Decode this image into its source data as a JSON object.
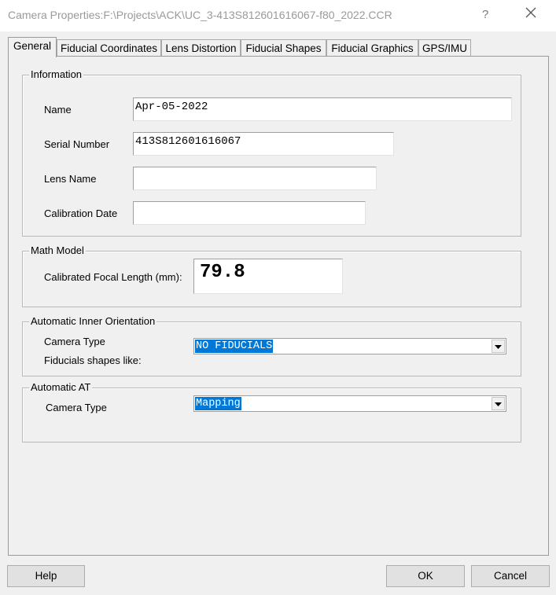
{
  "window": {
    "title": "Camera Properties:F:\\Projects\\ACK\\UC_3-413S812601616067-f80_2022.CCR",
    "help_glyph": "?",
    "close_icon": "close-icon"
  },
  "tabs": [
    {
      "label": "General",
      "active": true
    },
    {
      "label": "Fiducial Coordinates"
    },
    {
      "label": "Lens Distortion"
    },
    {
      "label": "Fiducial Shapes"
    },
    {
      "label": "Fiducial Graphics"
    },
    {
      "label": "GPS/IMU"
    }
  ],
  "information": {
    "title": "Information",
    "name_label": "Name",
    "name_value": "Apr-05-2022",
    "serial_label": "Serial Number",
    "serial_value": "413S812601616067",
    "lens_label": "Lens Name",
    "lens_value": "",
    "calib_date_label": "Calibration Date",
    "calib_date_value": ""
  },
  "math_model": {
    "title": "Math Model",
    "focal_label": "Calibrated Focal Length (mm):",
    "focal_value": "79.8"
  },
  "inner_orientation": {
    "title": "Automatic Inner Orientation",
    "camera_type_label": "Camera Type",
    "fiducials_label": "Fiducials shapes like:",
    "selected": "NO FIDUCIALS"
  },
  "automatic_at": {
    "title": "Automatic AT",
    "camera_type_label": "Camera Type",
    "selected": "Mapping"
  },
  "buttons": {
    "help": "Help",
    "ok": "OK",
    "cancel": "Cancel"
  },
  "colors": {
    "selection": "#0078d7",
    "background": "#f0f0f0"
  }
}
